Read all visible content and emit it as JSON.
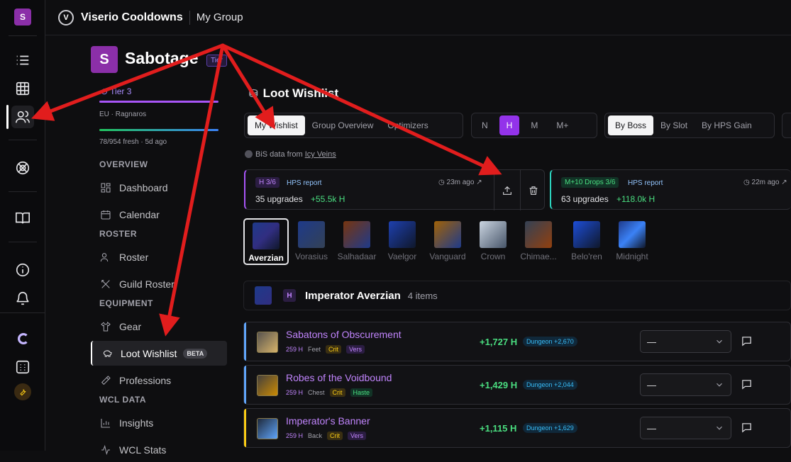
{
  "app": {
    "title": "Viserio Cooldowns",
    "section": "My Group",
    "user_initial": "S"
  },
  "rail": {
    "icons": [
      "list-icon",
      "grid-icon",
      "users-icon",
      "target-icon",
      "book-icon",
      "info-icon",
      "bell-icon",
      "logo-c-icon",
      "dotted-square-icon",
      "wrench-icon"
    ]
  },
  "guild": {
    "initial": "S",
    "name": "Sabotage",
    "tag": "Tier",
    "tier": "Tier 3",
    "region": "EU · Ragnaros",
    "fresh": "78/954 fresh · 5d ago"
  },
  "sidebar": {
    "sections": {
      "overview": "OVERVIEW",
      "roster": "ROSTER",
      "equipment": "EQUIPMENT",
      "wcl": "WCL DATA"
    },
    "items": {
      "dashboard": "Dashboard",
      "calendar": "Calendar",
      "roster": "Roster",
      "guild_roster": "Guild Roster",
      "gear": "Gear",
      "loot_wishlist": "Loot Wishlist",
      "beta": "BETA",
      "professions": "Professions",
      "insights": "Insights",
      "wcl_stats": "WCL Stats"
    }
  },
  "main": {
    "title": "Loot Wishlist",
    "view_tabs": [
      "My Wishlist",
      "Group Overview",
      "Optimizers"
    ],
    "difficulty": [
      "N",
      "H",
      "M",
      "M+"
    ],
    "sort_tabs": [
      "By Boss",
      "By Slot",
      "By HPS Gain"
    ],
    "bis_prefix": "BiS data from",
    "bis_source": "Icy Veins"
  },
  "cards": [
    {
      "badge": "H 3/6",
      "report": "HPS report",
      "upgrades": "35 upgrades",
      "gain": "+55.5k H",
      "ago": "23m ago"
    },
    {
      "badge": "M+10 Drops 3/6",
      "report": "HPS report",
      "upgrades": "63 upgrades",
      "gain": "+118.0k H",
      "ago": "22m ago"
    }
  ],
  "bosses": [
    "Averzian",
    "Vorasius",
    "Salhadaar",
    "Vaelgor",
    "Vanguard",
    "Crown",
    "Chimae...",
    "Belo'ren",
    "Midnight"
  ],
  "boss_header": {
    "difficulty": "H",
    "name": "Imperator Averzian",
    "count": "4 items"
  },
  "items": [
    {
      "name": "Sabatons of Obscurement",
      "ilvl": "259 H",
      "slot": "Feet",
      "stats": [
        "Crit",
        "Vers"
      ],
      "gain": "+1,727 H",
      "dungeon": "Dungeon +2,670",
      "select": "—",
      "accent": "#60a5fa"
    },
    {
      "name": "Robes of the Voidbound",
      "ilvl": "259 H",
      "slot": "Chest",
      "stats": [
        "Crit",
        "Haste"
      ],
      "gain": "+1,429 H",
      "dungeon": "Dungeon +2,044",
      "select": "—",
      "accent": "#60a5fa"
    },
    {
      "name": "Imperator's Banner",
      "ilvl": "259 H",
      "slot": "Back",
      "stats": [
        "Crit",
        "Vers"
      ],
      "gain": "+1,115 H",
      "dungeon": "Dungeon +1,629",
      "select": "—",
      "accent": "#facc15"
    }
  ],
  "colors": {
    "accent_purple": "#9333ea",
    "upgrade_green": "#4ade80",
    "annotation_red": "#e11d1d"
  }
}
